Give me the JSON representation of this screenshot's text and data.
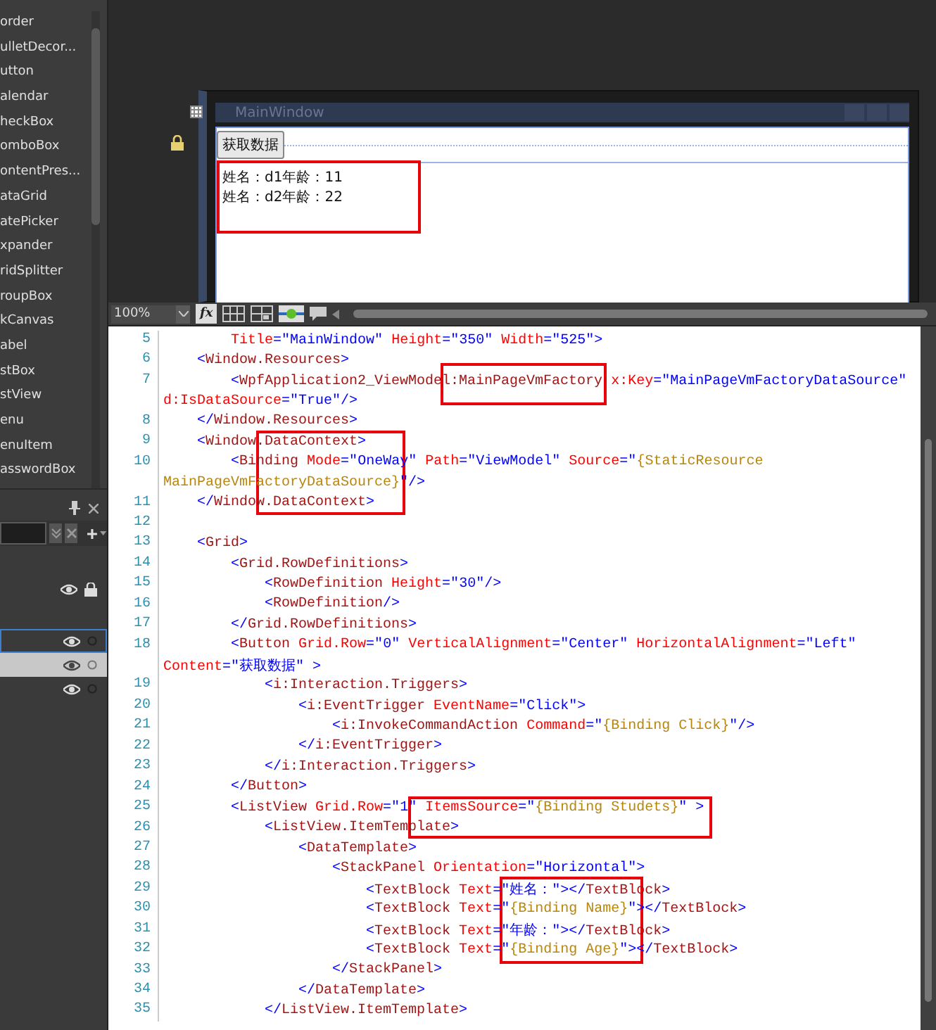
{
  "toolbox": {
    "items": [
      "order",
      "ulletDecor...",
      "utton",
      "alendar",
      "heckBox",
      "omboBox",
      "ontentPres...",
      "ataGrid",
      "atePicker",
      "xpander",
      "ridSplitter",
      "roupBox",
      "kCanvas",
      "abel",
      "stBox",
      "stView",
      "enu",
      "enuItem",
      "asswordBox"
    ]
  },
  "layers_panel": {
    "rows": [
      {
        "selected": false,
        "highlighted": false,
        "locked": true
      },
      {
        "selected": true,
        "highlighted": false,
        "locked": false
      },
      {
        "selected": false,
        "highlighted": true,
        "locked": false
      },
      {
        "selected": false,
        "highlighted": false,
        "locked": false
      }
    ]
  },
  "designer": {
    "window_title": "MainWindow",
    "button_label": "获取数据",
    "list_items": [
      "姓名：d1年龄：11",
      "姓名：d2年龄：22"
    ]
  },
  "toolbar": {
    "zoom": "100%",
    "formula_label": "fx"
  },
  "editor": {
    "lines": [
      {
        "number": "5",
        "segments": [
          {
            "kind": "attr",
            "text": "        Title"
          },
          {
            "kind": "punct",
            "text": "=\""
          },
          {
            "kind": "value",
            "text": "MainWindow"
          },
          {
            "kind": "punct",
            "text": "\" "
          },
          {
            "kind": "attr",
            "text": "Height"
          },
          {
            "kind": "punct",
            "text": "=\""
          },
          {
            "kind": "value",
            "text": "350"
          },
          {
            "kind": "punct",
            "text": "\" "
          },
          {
            "kind": "attr",
            "text": "Width"
          },
          {
            "kind": "punct",
            "text": "=\""
          },
          {
            "kind": "value",
            "text": "525"
          },
          {
            "kind": "punct",
            "text": "\">"
          }
        ]
      },
      {
        "number": "6",
        "segments": [
          {
            "kind": "punct",
            "text": "    <"
          },
          {
            "kind": "tag",
            "text": "Window.Resources"
          },
          {
            "kind": "punct",
            "text": ">"
          }
        ]
      },
      {
        "number": "7",
        "segments": [
          {
            "kind": "punct",
            "text": "        <"
          },
          {
            "kind": "tag",
            "text": "WpfApplication2_ViewModel:MainPageVmFactory"
          },
          {
            "kind": "attr",
            "text": " x:Key"
          },
          {
            "kind": "punct",
            "text": "=\""
          },
          {
            "kind": "value",
            "text": "MainPageVmFactoryDataSource"
          },
          {
            "kind": "punct",
            "text": "\""
          }
        ]
      },
      {
        "segments": [
          {
            "kind": "attr",
            "text": "d:IsDataSource"
          },
          {
            "kind": "punct",
            "text": "=\""
          },
          {
            "kind": "value",
            "text": "True"
          },
          {
            "kind": "punct",
            "text": "\"/>"
          }
        ]
      },
      {
        "number": "8",
        "segments": [
          {
            "kind": "punct",
            "text": "    </"
          },
          {
            "kind": "tag",
            "text": "Window.Resources"
          },
          {
            "kind": "punct",
            "text": ">"
          }
        ]
      },
      {
        "number": "9",
        "segments": [
          {
            "kind": "punct",
            "text": "    <"
          },
          {
            "kind": "tag",
            "text": "Window.DataContext"
          },
          {
            "kind": "punct",
            "text": ">"
          }
        ]
      },
      {
        "number": "10",
        "segments": [
          {
            "kind": "punct",
            "text": "        <"
          },
          {
            "kind": "tag",
            "text": "Binding"
          },
          {
            "kind": "attr",
            "text": " Mode"
          },
          {
            "kind": "punct",
            "text": "=\""
          },
          {
            "kind": "value",
            "text": "OneWay"
          },
          {
            "kind": "punct",
            "text": "\""
          },
          {
            "kind": "attr",
            "text": " Path"
          },
          {
            "kind": "punct",
            "text": "=\""
          },
          {
            "kind": "value",
            "text": "ViewModel"
          },
          {
            "kind": "punct",
            "text": "\""
          },
          {
            "kind": "attr",
            "text": " Source"
          },
          {
            "kind": "punct",
            "text": "=\""
          },
          {
            "kind": "binding",
            "text": "{StaticResource"
          }
        ]
      },
      {
        "segments": [
          {
            "kind": "binding",
            "text": "MainPageVmFactoryDataSource}"
          },
          {
            "kind": "punct",
            "text": "\"/>"
          }
        ]
      },
      {
        "number": "11",
        "segments": [
          {
            "kind": "punct",
            "text": "    </"
          },
          {
            "kind": "tag",
            "text": "Window.DataContext"
          },
          {
            "kind": "punct",
            "text": ">"
          }
        ]
      },
      {
        "number": "12"
      },
      {
        "number": "13",
        "segments": [
          {
            "kind": "punct",
            "text": "    <"
          },
          {
            "kind": "tag",
            "text": "Grid"
          },
          {
            "kind": "punct",
            "text": ">"
          }
        ]
      },
      {
        "number": "14",
        "segments": [
          {
            "kind": "punct",
            "text": "        <"
          },
          {
            "kind": "tag",
            "text": "Grid.RowDefinitions"
          },
          {
            "kind": "punct",
            "text": ">"
          }
        ]
      },
      {
        "number": "15",
        "segments": [
          {
            "kind": "punct",
            "text": "            <"
          },
          {
            "kind": "tag",
            "text": "RowDefinition"
          },
          {
            "kind": "attr",
            "text": " Height"
          },
          {
            "kind": "punct",
            "text": "=\""
          },
          {
            "kind": "value",
            "text": "30"
          },
          {
            "kind": "punct",
            "text": "\"/>"
          }
        ]
      },
      {
        "number": "16",
        "segments": [
          {
            "kind": "punct",
            "text": "            <"
          },
          {
            "kind": "tag",
            "text": "RowDefinition"
          },
          {
            "kind": "punct",
            "text": "/>"
          }
        ]
      },
      {
        "number": "17",
        "segments": [
          {
            "kind": "punct",
            "text": "        </"
          },
          {
            "kind": "tag",
            "text": "Grid.RowDefinitions"
          },
          {
            "kind": "punct",
            "text": ">"
          }
        ]
      },
      {
        "number": "18",
        "segments": [
          {
            "kind": "punct",
            "text": "        <"
          },
          {
            "kind": "tag",
            "text": "Button"
          },
          {
            "kind": "attr",
            "text": " Grid.Row"
          },
          {
            "kind": "punct",
            "text": "=\""
          },
          {
            "kind": "value",
            "text": "0"
          },
          {
            "kind": "punct",
            "text": "\""
          },
          {
            "kind": "attr",
            "text": " VerticalAlignment"
          },
          {
            "kind": "punct",
            "text": "=\""
          },
          {
            "kind": "value",
            "text": "Center"
          },
          {
            "kind": "punct",
            "text": "\""
          },
          {
            "kind": "attr",
            "text": " HorizontalAlignment"
          },
          {
            "kind": "punct",
            "text": "=\""
          },
          {
            "kind": "value",
            "text": "Left"
          },
          {
            "kind": "punct",
            "text": "\""
          }
        ]
      },
      {
        "segments": [
          {
            "kind": "attr",
            "text": "Content"
          },
          {
            "kind": "punct",
            "text": "=\""
          },
          {
            "kind": "value",
            "text": "获取数据"
          },
          {
            "kind": "punct",
            "text": "\" >"
          }
        ]
      },
      {
        "number": "19",
        "segments": [
          {
            "kind": "punct",
            "text": "            <"
          },
          {
            "kind": "tag",
            "text": "i:Interaction.Triggers"
          },
          {
            "kind": "punct",
            "text": ">"
          }
        ]
      },
      {
        "number": "20",
        "segments": [
          {
            "kind": "punct",
            "text": "                <"
          },
          {
            "kind": "tag",
            "text": "i:EventTrigger"
          },
          {
            "kind": "attr",
            "text": " EventName"
          },
          {
            "kind": "punct",
            "text": "=\""
          },
          {
            "kind": "value",
            "text": "Click"
          },
          {
            "kind": "punct",
            "text": "\">"
          }
        ]
      },
      {
        "number": "21",
        "segments": [
          {
            "kind": "punct",
            "text": "                    <"
          },
          {
            "kind": "tag",
            "text": "i:InvokeCommandAction"
          },
          {
            "kind": "attr",
            "text": " Command"
          },
          {
            "kind": "punct",
            "text": "=\""
          },
          {
            "kind": "binding",
            "text": "{Binding Click}"
          },
          {
            "kind": "punct",
            "text": "\"/>"
          }
        ]
      },
      {
        "number": "22",
        "segments": [
          {
            "kind": "punct",
            "text": "                </"
          },
          {
            "kind": "tag",
            "text": "i:EventTrigger"
          },
          {
            "kind": "punct",
            "text": ">"
          }
        ]
      },
      {
        "number": "23",
        "segments": [
          {
            "kind": "punct",
            "text": "            </"
          },
          {
            "kind": "tag",
            "text": "i:Interaction.Triggers"
          },
          {
            "kind": "punct",
            "text": ">"
          }
        ]
      },
      {
        "number": "24",
        "segments": [
          {
            "kind": "punct",
            "text": "        </"
          },
          {
            "kind": "tag",
            "text": "Button"
          },
          {
            "kind": "punct",
            "text": ">"
          }
        ]
      },
      {
        "number": "25",
        "segments": [
          {
            "kind": "punct",
            "text": "        <"
          },
          {
            "kind": "tag",
            "text": "ListView"
          },
          {
            "kind": "attr",
            "text": " Grid.Row"
          },
          {
            "kind": "punct",
            "text": "=\""
          },
          {
            "kind": "value",
            "text": "1"
          },
          {
            "kind": "punct",
            "text": "\""
          },
          {
            "kind": "attr",
            "text": " ItemsSource"
          },
          {
            "kind": "punct",
            "text": "=\""
          },
          {
            "kind": "binding",
            "text": "{Binding Studets}"
          },
          {
            "kind": "punct",
            "text": "\" >"
          }
        ]
      },
      {
        "number": "26",
        "segments": [
          {
            "kind": "punct",
            "text": "            <"
          },
          {
            "kind": "tag",
            "text": "ListView.ItemTemplate"
          },
          {
            "kind": "punct",
            "text": ">"
          }
        ]
      },
      {
        "number": "27",
        "segments": [
          {
            "kind": "punct",
            "text": "                <"
          },
          {
            "kind": "tag",
            "text": "DataTemplate"
          },
          {
            "kind": "punct",
            "text": ">"
          }
        ]
      },
      {
        "number": "28",
        "segments": [
          {
            "kind": "punct",
            "text": "                    <"
          },
          {
            "kind": "tag",
            "text": "StackPanel"
          },
          {
            "kind": "attr",
            "text": " Orientation"
          },
          {
            "kind": "punct",
            "text": "=\""
          },
          {
            "kind": "value",
            "text": "Horizontal"
          },
          {
            "kind": "punct",
            "text": "\">"
          }
        ]
      },
      {
        "number": "29",
        "segments": [
          {
            "kind": "punct",
            "text": "                        <"
          },
          {
            "kind": "tag",
            "text": "TextBlock"
          },
          {
            "kind": "attr",
            "text": " Text"
          },
          {
            "kind": "punct",
            "text": "=\""
          },
          {
            "kind": "value",
            "text": "姓名："
          },
          {
            "kind": "punct",
            "text": "\"></"
          },
          {
            "kind": "tag",
            "text": "TextBlock"
          },
          {
            "kind": "punct",
            "text": ">"
          }
        ]
      },
      {
        "number": "30",
        "segments": [
          {
            "kind": "punct",
            "text": "                        <"
          },
          {
            "kind": "tag",
            "text": "TextBlock"
          },
          {
            "kind": "attr",
            "text": " Text"
          },
          {
            "kind": "punct",
            "text": "=\""
          },
          {
            "kind": "binding",
            "text": "{Binding Name}"
          },
          {
            "kind": "punct",
            "text": "\"></"
          },
          {
            "kind": "tag",
            "text": "TextBlock"
          },
          {
            "kind": "punct",
            "text": ">"
          }
        ]
      },
      {
        "number": "31",
        "segments": [
          {
            "kind": "punct",
            "text": "                        <"
          },
          {
            "kind": "tag",
            "text": "TextBlock"
          },
          {
            "kind": "attr",
            "text": " Text"
          },
          {
            "kind": "punct",
            "text": "=\""
          },
          {
            "kind": "value",
            "text": "年龄："
          },
          {
            "kind": "punct",
            "text": "\"></"
          },
          {
            "kind": "tag",
            "text": "TextBlock"
          },
          {
            "kind": "punct",
            "text": ">"
          }
        ]
      },
      {
        "number": "32",
        "segments": [
          {
            "kind": "punct",
            "text": "                        <"
          },
          {
            "kind": "tag",
            "text": "TextBlock"
          },
          {
            "kind": "attr",
            "text": " Text"
          },
          {
            "kind": "punct",
            "text": "=\""
          },
          {
            "kind": "binding",
            "text": "{Binding Age}"
          },
          {
            "kind": "punct",
            "text": "\"></"
          },
          {
            "kind": "tag",
            "text": "TextBlock"
          },
          {
            "kind": "punct",
            "text": ">"
          }
        ]
      },
      {
        "number": "33",
        "segments": [
          {
            "kind": "punct",
            "text": "                    </"
          },
          {
            "kind": "tag",
            "text": "StackPanel"
          },
          {
            "kind": "punct",
            "text": ">"
          }
        ]
      },
      {
        "number": "34",
        "segments": [
          {
            "kind": "punct",
            "text": "                </"
          },
          {
            "kind": "tag",
            "text": "DataTemplate"
          },
          {
            "kind": "punct",
            "text": ">"
          }
        ]
      },
      {
        "number": "35",
        "segments": [
          {
            "kind": "punct",
            "text": "            </"
          },
          {
            "kind": "tag",
            "text": "ListView.ItemTemplate"
          },
          {
            "kind": "punct",
            "text": ">"
          }
        ]
      }
    ]
  }
}
